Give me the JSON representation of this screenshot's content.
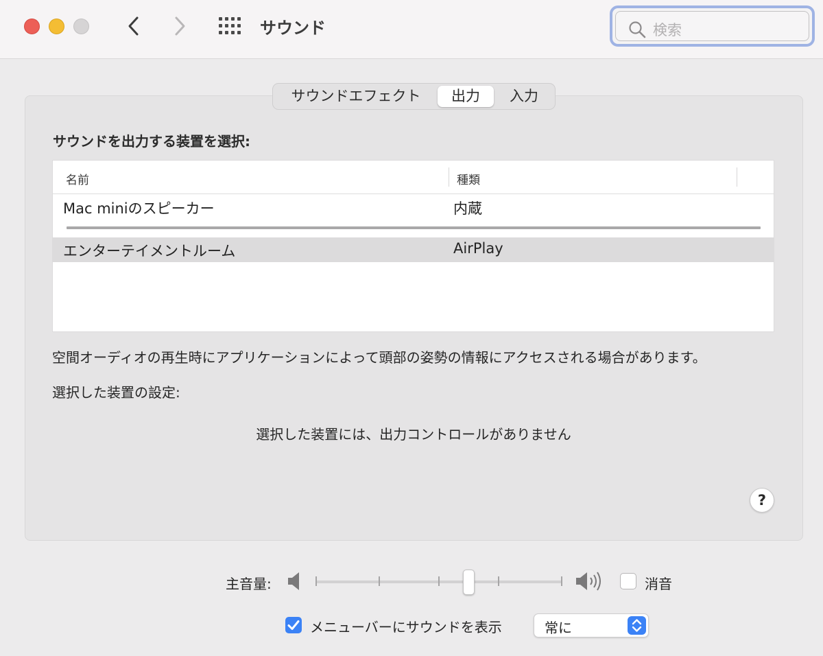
{
  "window": {
    "title": "サウンド",
    "search_placeholder": "検索"
  },
  "tabs": [
    {
      "label": "サウンドエフェクト",
      "selected": false
    },
    {
      "label": "出力",
      "selected": true
    },
    {
      "label": "入力",
      "selected": false
    }
  ],
  "output": {
    "section_title": "サウンドを出力する装置を選択:",
    "columns": {
      "name": "名前",
      "type": "種類"
    },
    "devices": [
      {
        "name": "Mac miniのスピーカー",
        "type": "内蔵",
        "selected": false
      },
      {
        "name": "エンターテイメントルーム",
        "type": "AirPlay",
        "selected": true
      }
    ],
    "spatial_audio_note": "空間オーディオの再生時にアプリケーションによって頭部の姿勢の情報にアクセスされる場合があります。",
    "selected_settings_label": "選択した装置の設定:",
    "no_controls_message": "選択した装置には、出力コントロールがありません",
    "help_label": "?"
  },
  "volume": {
    "label": "主音量:",
    "level": 0.62,
    "mute_label": "消音",
    "muted": false
  },
  "menubar": {
    "show_label": "メニューバーにサウンドを表示",
    "checked": true,
    "option_value": "常に"
  },
  "colors": {
    "accent": "#3b82f6",
    "close": "#ec5f57",
    "minimize": "#f4bd34",
    "zoom_disabled": "#d6d4d5"
  }
}
